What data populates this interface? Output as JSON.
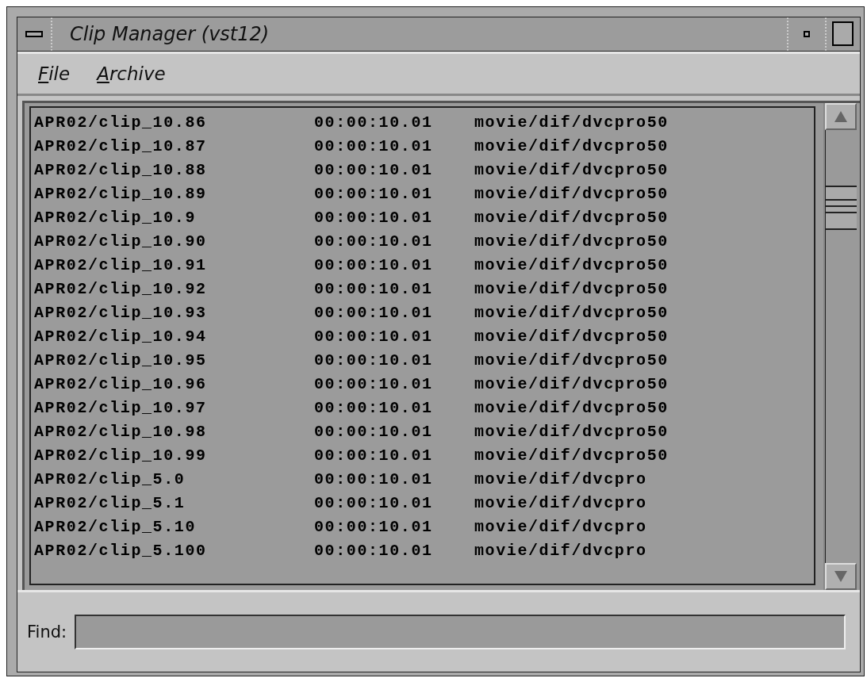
{
  "window": {
    "title": "Clip Manager (vst12)"
  },
  "menu": [
    {
      "label": "File"
    },
    {
      "label": "Archive"
    }
  ],
  "clips": [
    {
      "name": "APR02/clip_10.86",
      "duration": "00:00:10.01",
      "format": "movie/dif/dvcpro50"
    },
    {
      "name": "APR02/clip_10.87",
      "duration": "00:00:10.01",
      "format": "movie/dif/dvcpro50"
    },
    {
      "name": "APR02/clip_10.88",
      "duration": "00:00:10.01",
      "format": "movie/dif/dvcpro50"
    },
    {
      "name": "APR02/clip_10.89",
      "duration": "00:00:10.01",
      "format": "movie/dif/dvcpro50"
    },
    {
      "name": "APR02/clip_10.9",
      "duration": "00:00:10.01",
      "format": "movie/dif/dvcpro50"
    },
    {
      "name": "APR02/clip_10.90",
      "duration": "00:00:10.01",
      "format": "movie/dif/dvcpro50"
    },
    {
      "name": "APR02/clip_10.91",
      "duration": "00:00:10.01",
      "format": "movie/dif/dvcpro50"
    },
    {
      "name": "APR02/clip_10.92",
      "duration": "00:00:10.01",
      "format": "movie/dif/dvcpro50"
    },
    {
      "name": "APR02/clip_10.93",
      "duration": "00:00:10.01",
      "format": "movie/dif/dvcpro50"
    },
    {
      "name": "APR02/clip_10.94",
      "duration": "00:00:10.01",
      "format": "movie/dif/dvcpro50"
    },
    {
      "name": "APR02/clip_10.95",
      "duration": "00:00:10.01",
      "format": "movie/dif/dvcpro50"
    },
    {
      "name": "APR02/clip_10.96",
      "duration": "00:00:10.01",
      "format": "movie/dif/dvcpro50"
    },
    {
      "name": "APR02/clip_10.97",
      "duration": "00:00:10.01",
      "format": "movie/dif/dvcpro50"
    },
    {
      "name": "APR02/clip_10.98",
      "duration": "00:00:10.01",
      "format": "movie/dif/dvcpro50"
    },
    {
      "name": "APR02/clip_10.99",
      "duration": "00:00:10.01",
      "format": "movie/dif/dvcpro50"
    },
    {
      "name": "APR02/clip_5.0",
      "duration": "00:00:10.01",
      "format": "movie/dif/dvcpro"
    },
    {
      "name": "APR02/clip_5.1",
      "duration": "00:00:10.01",
      "format": "movie/dif/dvcpro"
    },
    {
      "name": "APR02/clip_5.10",
      "duration": "00:00:10.01",
      "format": "movie/dif/dvcpro"
    },
    {
      "name": "APR02/clip_5.100",
      "duration": "00:00:10.01",
      "format": "movie/dif/dvcpro"
    }
  ],
  "find": {
    "label": "Find:"
  }
}
